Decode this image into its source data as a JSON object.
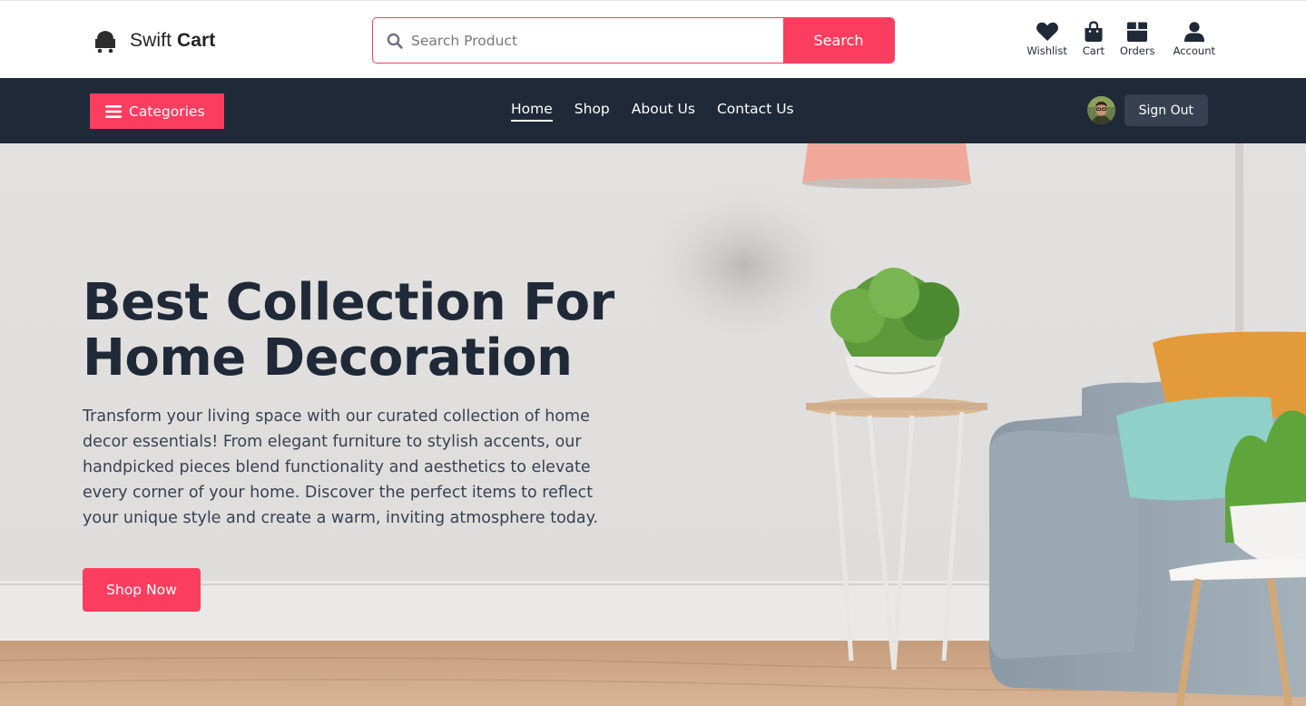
{
  "brand": {
    "name_prefix": "Swift",
    "name_bold": "Cart"
  },
  "search": {
    "placeholder": "Search Product",
    "button_label": "Search"
  },
  "user_links": [
    {
      "label": "Wishlist",
      "icon": "heart-icon"
    },
    {
      "label": "Cart",
      "icon": "shopping-bag-icon"
    },
    {
      "label": "Orders",
      "icon": "box-icon"
    },
    {
      "label": "Account",
      "icon": "user-icon"
    }
  ],
  "nav": {
    "categories_label": "Categories",
    "links": [
      {
        "label": "Home",
        "active": true
      },
      {
        "label": "Shop",
        "active": false
      },
      {
        "label": "About Us",
        "active": false
      },
      {
        "label": "Contact Us",
        "active": false
      }
    ],
    "sign_out_label": "Sign Out"
  },
  "hero": {
    "title_line1": "Best Collection For",
    "title_line2": "Home Decoration",
    "description": "Transform your living space with our curated collection of home decor essentials! From elegant furniture to stylish accents, our handpicked pieces blend functionality and aesthetics to elevate every corner of your home. Discover the perfect items to reflect your unique style and create a warm, inviting atmosphere today.",
    "cta_label": "Shop Now"
  },
  "colors": {
    "accent": "#fb3e5f",
    "nav_background": "#1f2937",
    "sign_out_background": "#374151",
    "text_dark": "#1f2937"
  }
}
